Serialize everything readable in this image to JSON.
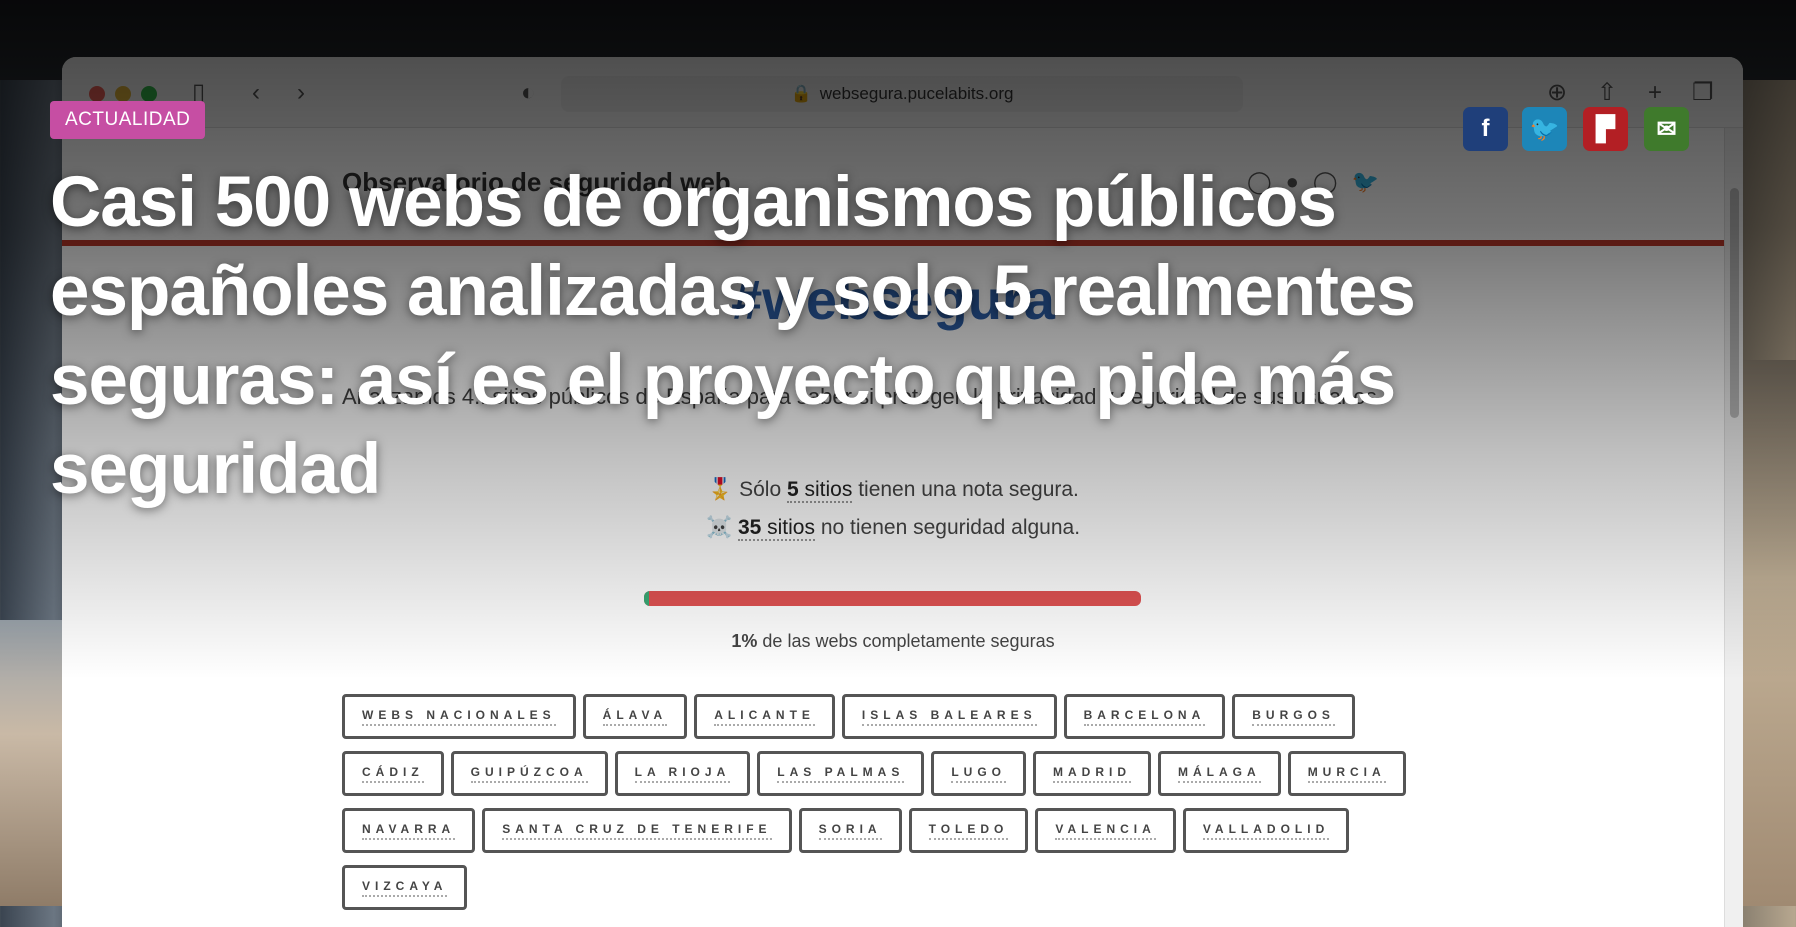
{
  "category": "ACTUALIDAD",
  "headline": "Casi 500 webs de organismos públicos españoles analizadas y solo 5 realmentes seguras: así es el proyecto que pide más seguridad",
  "share": [
    {
      "name": "facebook",
      "glyph": "f",
      "color": "#1f3f7a"
    },
    {
      "name": "twitter",
      "glyph": "🐦",
      "color": "#1d86b8"
    },
    {
      "name": "flipboard",
      "glyph": "▛",
      "color": "#b31f24"
    },
    {
      "name": "email",
      "glyph": "✉",
      "color": "#3f7a2c"
    }
  ],
  "browser": {
    "url": "websegura.pucelabits.org"
  },
  "site": {
    "brand": "Observatorio de seguridad web",
    "hashtag": "#websegura",
    "intro": "Analizamos 4.. sitios públicos de España para saber si protegen la privacidad y seguridad de sus usuarios.",
    "stat_secure_pre": "Sólo",
    "stat_secure_num": "5",
    "stat_secure_unit": "sitios",
    "stat_secure_post": "tienen una nota segura.",
    "stat_none_num": "35",
    "stat_none_unit": "sitios",
    "stat_none_post": "no tienen seguridad alguna.",
    "progress_percent": 1,
    "pct_value": "1%",
    "pct_text": "de las webs completamente seguras",
    "regions": [
      "WEBS NACIONALES",
      "ÁLAVA",
      "ALICANTE",
      "ISLAS BALEARES",
      "BARCELONA",
      "BURGOS",
      "CÁDIZ",
      "GUIPÚZCOA",
      "LA RIOJA",
      "LAS PALMAS",
      "LUGO",
      "MADRID",
      "MÁLAGA",
      "MURCIA",
      "NAVARRA",
      "SANTA CRUZ DE TENERIFE",
      "SORIA",
      "TOLEDO",
      "VALENCIA",
      "VALLADOLID",
      "VIZCAYA"
    ]
  }
}
